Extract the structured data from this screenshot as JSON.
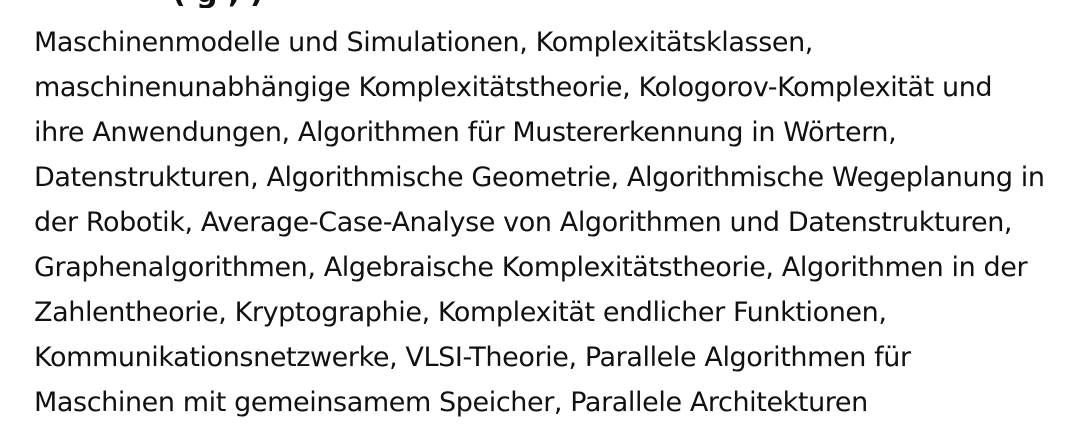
{
  "document": {
    "lines": [
      "Maschinenmodelle und Simulationen, Komplexitätsklassen,",
      "maschinenunabhängige Komplexitätstheorie, Kologorov-Komplexität und",
      "ihre Anwendungen, Algorithmen für Mustererkennung in Wörtern,",
      "Datenstrukturen, Algorithmische Geometrie, Algorithmische Wegeplanung in",
      "der Robotik, Average-Case-Analyse von Algorithmen und Datenstrukturen,",
      "Graphenalgorithmen, Algebraische Komplexitätstheorie, Algorithmen in der",
      "Zahlentheorie, Kryptographie, Komplexität endlicher Funktionen,",
      "Kommunikationsnetzwerke, VLSI-Theorie, Parallele Algorithmen für",
      "Maschinen mit gemeinsamem Speicher, Parallele Architekturen"
    ]
  }
}
